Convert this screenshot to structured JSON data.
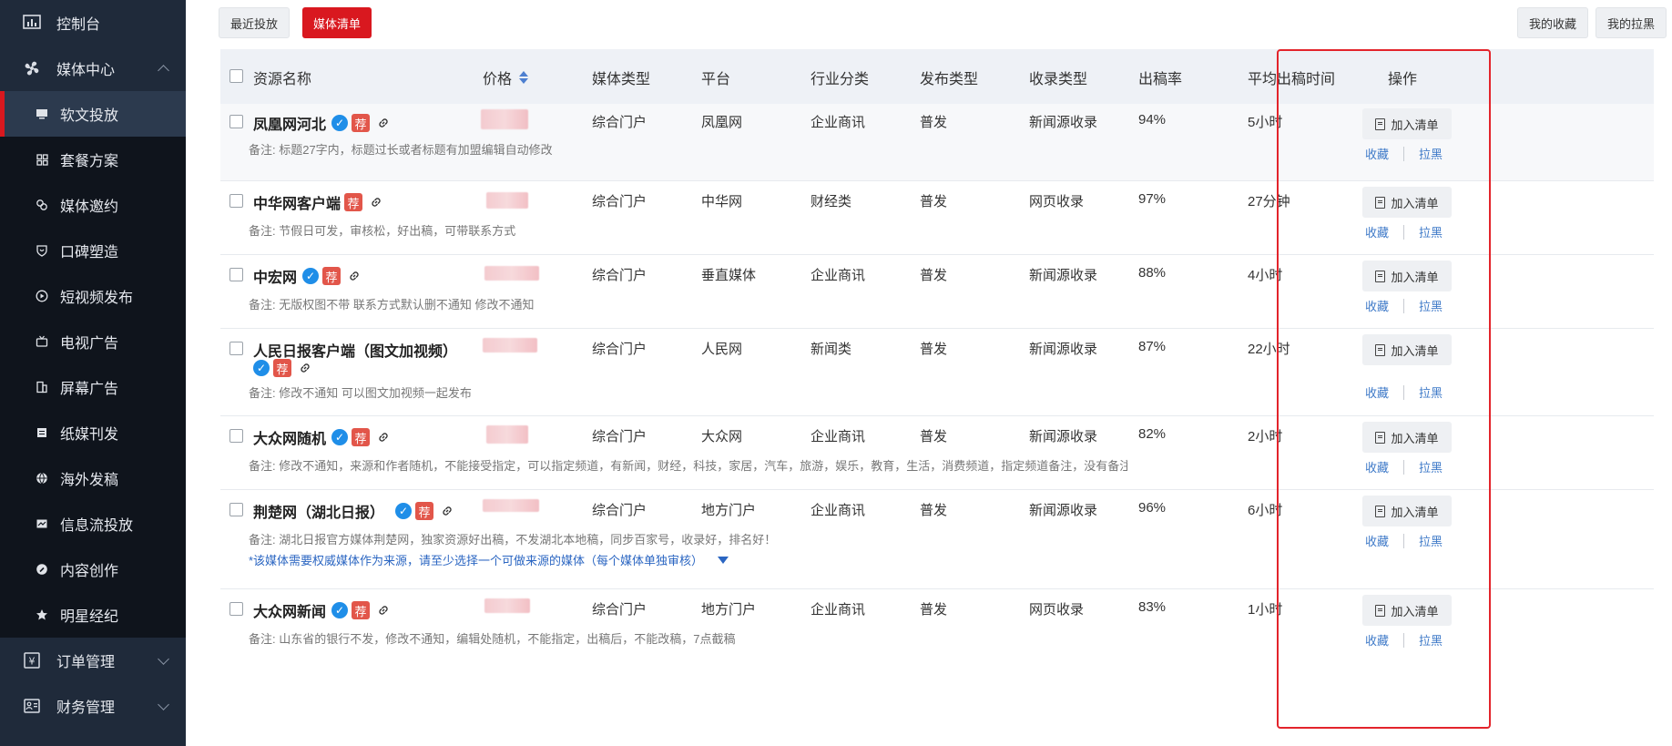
{
  "sidebar": {
    "dashboard": "控制台",
    "media_center": "媒体中心",
    "items": [
      {
        "label": "软文投放",
        "icon": "monitor-icon",
        "active": true
      },
      {
        "label": "套餐方案",
        "icon": "grid-icon"
      },
      {
        "label": "媒体邀约",
        "icon": "link-icon"
      },
      {
        "label": "口碑塑造",
        "icon": "shield-icon"
      },
      {
        "label": "短视频发布",
        "icon": "play-icon"
      },
      {
        "label": "电视广告",
        "icon": "tv-icon"
      },
      {
        "label": "屏幕广告",
        "icon": "screen-icon"
      },
      {
        "label": "纸媒刊发",
        "icon": "newspaper-icon"
      },
      {
        "label": "海外发稿",
        "icon": "globe-icon"
      },
      {
        "label": "信息流投放",
        "icon": "feed-icon"
      },
      {
        "label": "内容创作",
        "icon": "pen-icon"
      },
      {
        "label": "明星经纪",
        "icon": "star-icon"
      }
    ],
    "orders": "订单管理",
    "finance": "财务管理"
  },
  "toolbar": {
    "recent": "最近投放",
    "media_list": "媒体清单",
    "favorites": "我的收藏",
    "blacklist": "我的拉黑"
  },
  "table": {
    "headers": {
      "name": "资源名称",
      "price": "价格",
      "media_type": "媒体类型",
      "platform": "平台",
      "industry": "行业分类",
      "publish_type": "发布类型",
      "index_type": "收录类型",
      "rate": "出稿率",
      "avg_time": "平均出稿时间",
      "ops": "操作"
    },
    "rows": [
      {
        "name": "凤凰网河北",
        "media_type": "综合门户",
        "platform": "凤凰网",
        "industry": "企业商讯",
        "publish": "普发",
        "index": "新闻源收录",
        "rate": "94%",
        "time": "5小时",
        "note": "备注: 标题27字内，标题过长或者标题有加盟编辑自动修改"
      },
      {
        "name": "中华网客户端",
        "media_type": "综合门户",
        "platform": "中华网",
        "industry": "财经类",
        "publish": "普发",
        "index": "网页收录",
        "rate": "97%",
        "time": "27分钟",
        "note": "备注: 节假日可发，审核松，好出稿，可带联系方式"
      },
      {
        "name": "中宏网",
        "media_type": "综合门户",
        "platform": "垂直媒体",
        "industry": "企业商讯",
        "publish": "普发",
        "index": "新闻源收录",
        "rate": "88%",
        "time": "4小时",
        "note": "备注: 无版权图不带 联系方式默认删不通知 修改不通知"
      },
      {
        "name": "人民日报客户端（图文加视频）",
        "media_type": "综合门户",
        "platform": "人民网",
        "industry": "新闻类",
        "publish": "普发",
        "index": "新闻源收录",
        "rate": "87%",
        "time": "22小时",
        "note": "备注: 修改不通知 可以图文加视频一起发布"
      },
      {
        "name": "大众网随机",
        "media_type": "综合门户",
        "platform": "大众网",
        "industry": "企业商讯",
        "publish": "普发",
        "index": "新闻源收录",
        "rate": "82%",
        "time": "2小时",
        "note": "备注: 修改不通知，来源和作者随机，不能接受指定，可以指定频道，有新闻，财经，科技，家居，汽车，旅游，娱乐，教育，生活，消费频道，指定频道备注，没有备注默认新闻频道"
      },
      {
        "name": "荆楚网（湖北日报）",
        "media_type": "综合门户",
        "platform": "地方门户",
        "industry": "企业商讯",
        "publish": "普发",
        "index": "新闻源收录",
        "rate": "96%",
        "time": "6小时",
        "note": "备注: 湖北日报官方媒体荆楚网，独家资源好出稿，不发湖北本地稿，同步百家号，收录好，排名好！",
        "notice": "*该媒体需要权威媒体作为来源，请至少选择一个可做来源的媒体（每个媒体单独审核）"
      },
      {
        "name": "大众网新闻",
        "media_type": "综合门户",
        "platform": "地方门户",
        "industry": "企业商讯",
        "publish": "普发",
        "index": "网页收录",
        "rate": "83%",
        "time": "1小时",
        "note": "备注: 山东省的银行不发，修改不通知，编辑处随机，不能指定，出稿后，不能改稿，7点截稿"
      }
    ],
    "badge_rec": "荐",
    "add_label": "加入清单",
    "fav_label": "收藏",
    "block_label": "拉黑"
  }
}
